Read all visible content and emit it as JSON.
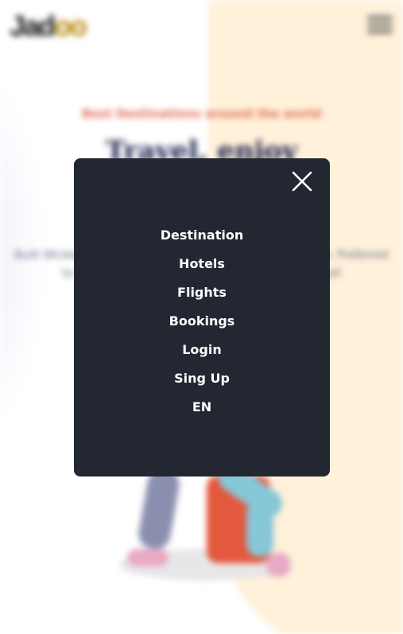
{
  "background": {
    "logo": {
      "text_main": "Jad",
      "text_accent": "oo"
    },
    "tagline": "Best Destinations around the world",
    "heading": "Travel, enjoy",
    "body_text": "Built Wicket longer admire do barton vanity itself do in it. Preferred to sportsmen it engrossed listening. Park gate sell"
  },
  "menu": {
    "items": [
      {
        "label": "Destination"
      },
      {
        "label": "Hotels"
      },
      {
        "label": "Flights"
      },
      {
        "label": "Bookings"
      },
      {
        "label": "Login"
      },
      {
        "label": "Sing Up"
      },
      {
        "label": "EN"
      }
    ]
  },
  "colors": {
    "modal_background": "#222731",
    "menu_text": "#ffffff",
    "cream_accent": "#fff1da",
    "tagline": "#df6951"
  }
}
